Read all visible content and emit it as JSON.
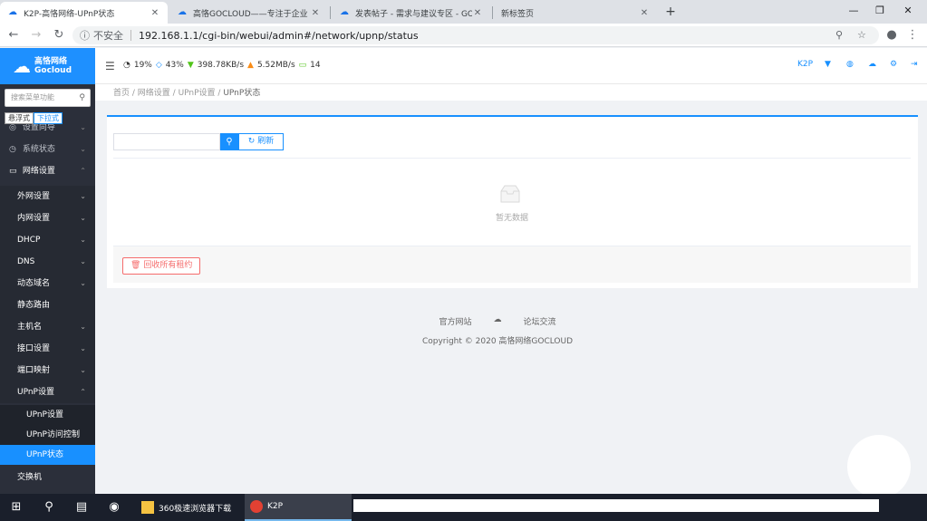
{
  "browser": {
    "tabs": [
      {
        "title": "K2P-高恪网络-UPnP状态",
        "close": "✕"
      },
      {
        "title": "高恪GOCLOUD——专注于企业",
        "close": "✕"
      },
      {
        "title": "发表帖子 - 需求与建议专区 - GO",
        "close": "✕"
      },
      {
        "title": "新标签页",
        "close": "✕"
      }
    ],
    "new_tab": "+",
    "win_min": "—",
    "win_restore": "❐",
    "win_close": "✕",
    "insecure_label": "不安全",
    "url": "192.168.1.1/cgi-bin/webui/admin#/network/upnp/status"
  },
  "header": {
    "logo_cn": "高恪网络",
    "logo_en": "Gocloud",
    "stats": {
      "cpu": "19%",
      "mem": "43%",
      "down": "398.78KB/s",
      "up": "5.52MB/s",
      "devices": "14"
    },
    "model": "K2P"
  },
  "sidebar": {
    "search_placeholder": "搜索菜单功能",
    "mode_float": "悬浮式",
    "mode_dropdown": "下拉式",
    "items": [
      {
        "label": "设置向导"
      },
      {
        "label": "系统状态"
      },
      {
        "label": "网络设置"
      }
    ],
    "network_sub": [
      {
        "label": "外网设置"
      },
      {
        "label": "内网设置"
      },
      {
        "label": "DHCP"
      },
      {
        "label": "DNS"
      },
      {
        "label": "动态域名"
      },
      {
        "label": "静态路由"
      },
      {
        "label": "主机名"
      },
      {
        "label": "接口设置"
      },
      {
        "label": "端口映射"
      },
      {
        "label": "UPnP设置"
      }
    ],
    "upnp_sub": [
      {
        "label": "UPnP设置"
      },
      {
        "label": "UPnP访问控制"
      },
      {
        "label": "UPnP状态"
      }
    ],
    "more": {
      "label": "交换机"
    }
  },
  "breadcrumb": [
    "首页",
    "网络设置",
    "UPnP设置",
    "UPnP状态"
  ],
  "main": {
    "refresh_label": "刷新",
    "empty_text": "暂无数据",
    "release_label": "回收所有租约"
  },
  "footer": {
    "official_site": "官方网站",
    "forum": "论坛交流",
    "copyright": "Copyright © 2020 高恪网络GOCLOUD"
  },
  "taskbar": {
    "app1": "360极速浏览器下载",
    "app2": "K2P"
  }
}
